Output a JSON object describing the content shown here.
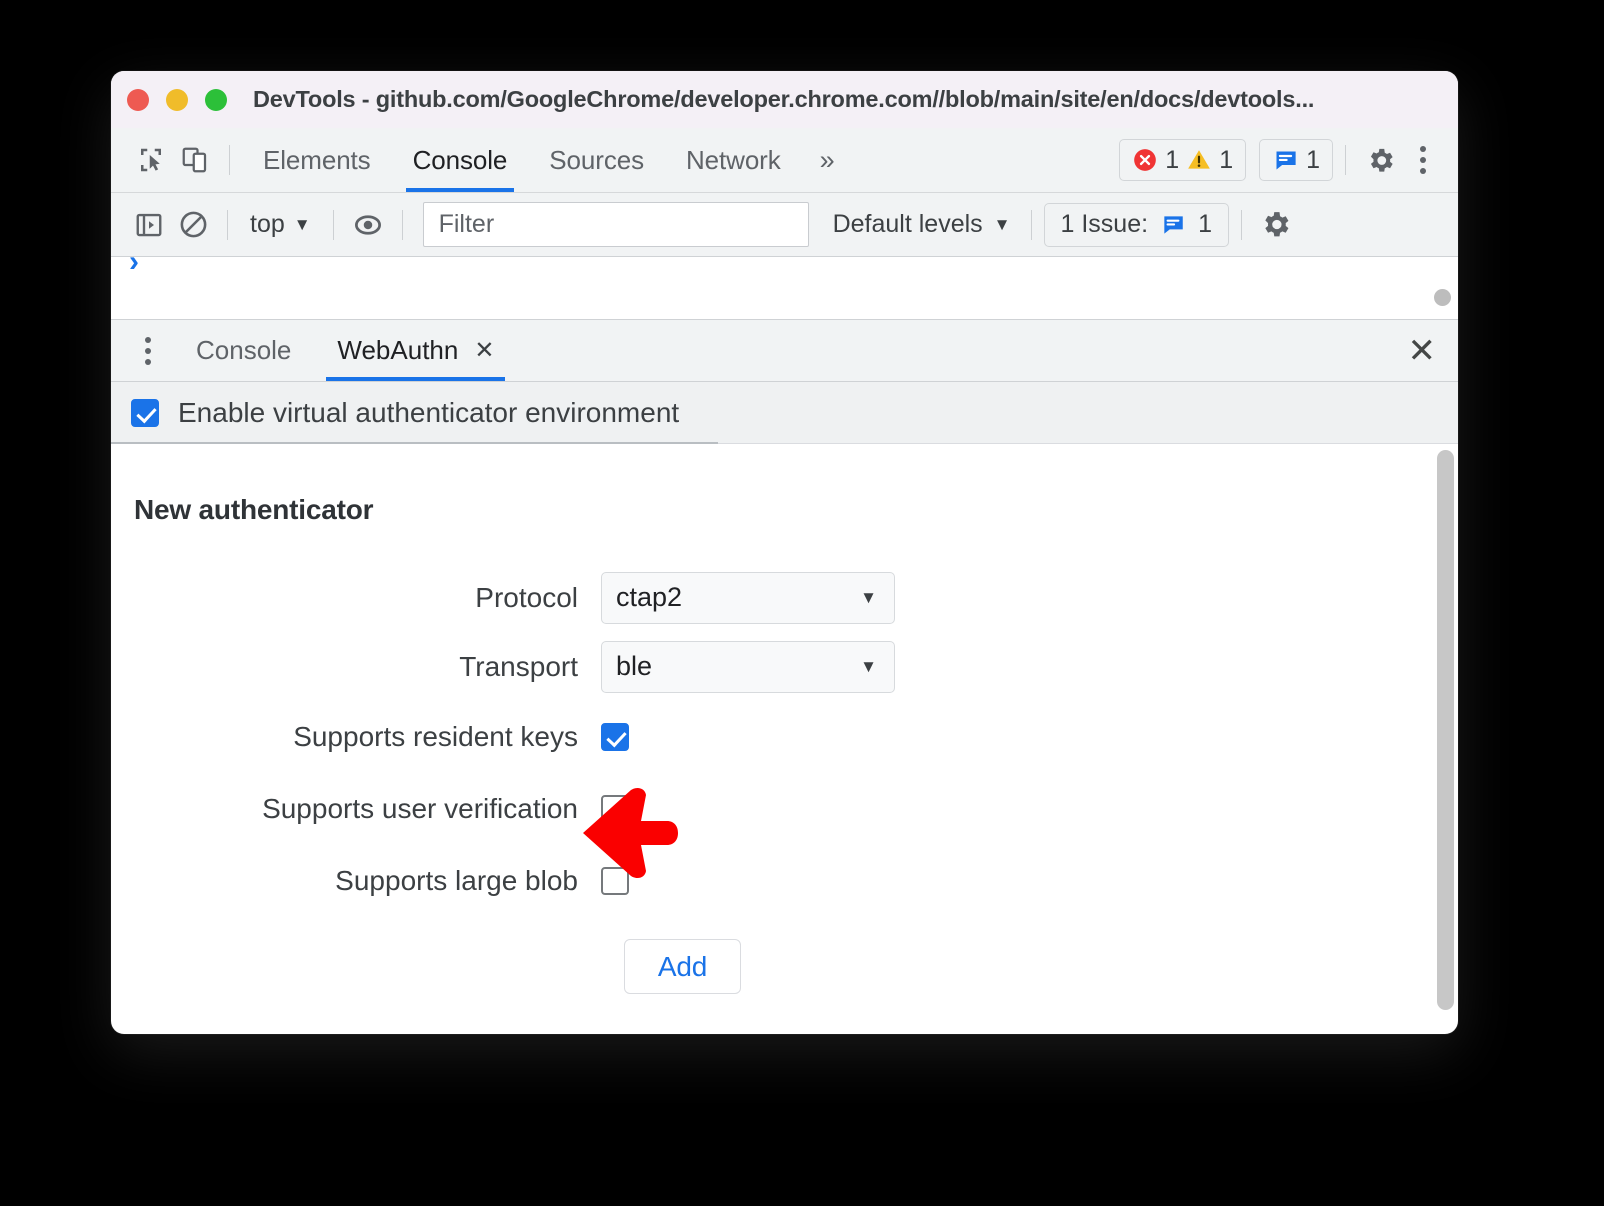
{
  "window": {
    "title": "DevTools - github.com/GoogleChrome/developer.chrome.com//blob/main/site/en/docs/devtools...",
    "traffic_lights": [
      "close-button",
      "minimize-button",
      "maximize-button"
    ],
    "colors": {
      "titlebar_bg": "#f4f0f6",
      "toolbar_bg": "#f1f3f4",
      "accent_blue": "#1a73e8",
      "error_red": "#f03434",
      "warning_yellow": "#f6be23",
      "annotation_red": "#fa0000"
    }
  },
  "devtools_tabbar": {
    "inspect_icon": "inspect-cursor-icon",
    "device_icon": "device-toolbar-icon",
    "tabs": [
      {
        "label": "Elements",
        "active": false
      },
      {
        "label": "Console",
        "active": true
      },
      {
        "label": "Sources",
        "active": false
      },
      {
        "label": "Network",
        "active": false
      }
    ],
    "more_tabs_label": "»",
    "error_count": "1",
    "warning_count": "1",
    "message_count": "1",
    "settings_icon": "gear-icon",
    "more_icon": "kebab-menu-icon"
  },
  "console_toolbar": {
    "sidebar_toggle_icon": "console-sidebar-icon",
    "clear_icon": "clear-console-icon",
    "context": "top",
    "context_caret": "▼",
    "eye_icon": "live-expression-eye-icon",
    "filter_placeholder": "Filter",
    "filter_value": "",
    "levels_label": "Default levels",
    "levels_caret": "▼",
    "issues_label": "1 Issue:",
    "issues_count": "1",
    "settings_icon": "gear-icon"
  },
  "console_output": {
    "prompt_symbol": "›"
  },
  "drawer": {
    "menu_icon": "kebab-menu-icon",
    "tabs": [
      {
        "label": "Console",
        "active": false,
        "closable": false
      },
      {
        "label": "WebAuthn",
        "active": true,
        "closable": true
      }
    ],
    "tab_close_glyph": "✕",
    "close_glyph": "✕"
  },
  "webauthn": {
    "enable_label": "Enable virtual authenticator environment",
    "enable_checked": true,
    "section_title": "New authenticator",
    "fields": [
      {
        "label": "Protocol",
        "value": "ctap2",
        "type": "select"
      },
      {
        "label": "Transport",
        "value": "ble",
        "type": "select"
      }
    ],
    "checkboxes": [
      {
        "label": "Supports resident keys",
        "checked": true
      },
      {
        "label": "Supports user verification",
        "checked": false
      },
      {
        "label": "Supports large blob",
        "checked": false
      }
    ],
    "add_label": "Add"
  },
  "annotation": {
    "arrow": "left-pointing-arrow",
    "target": "supports-large-blob-checkbox"
  }
}
